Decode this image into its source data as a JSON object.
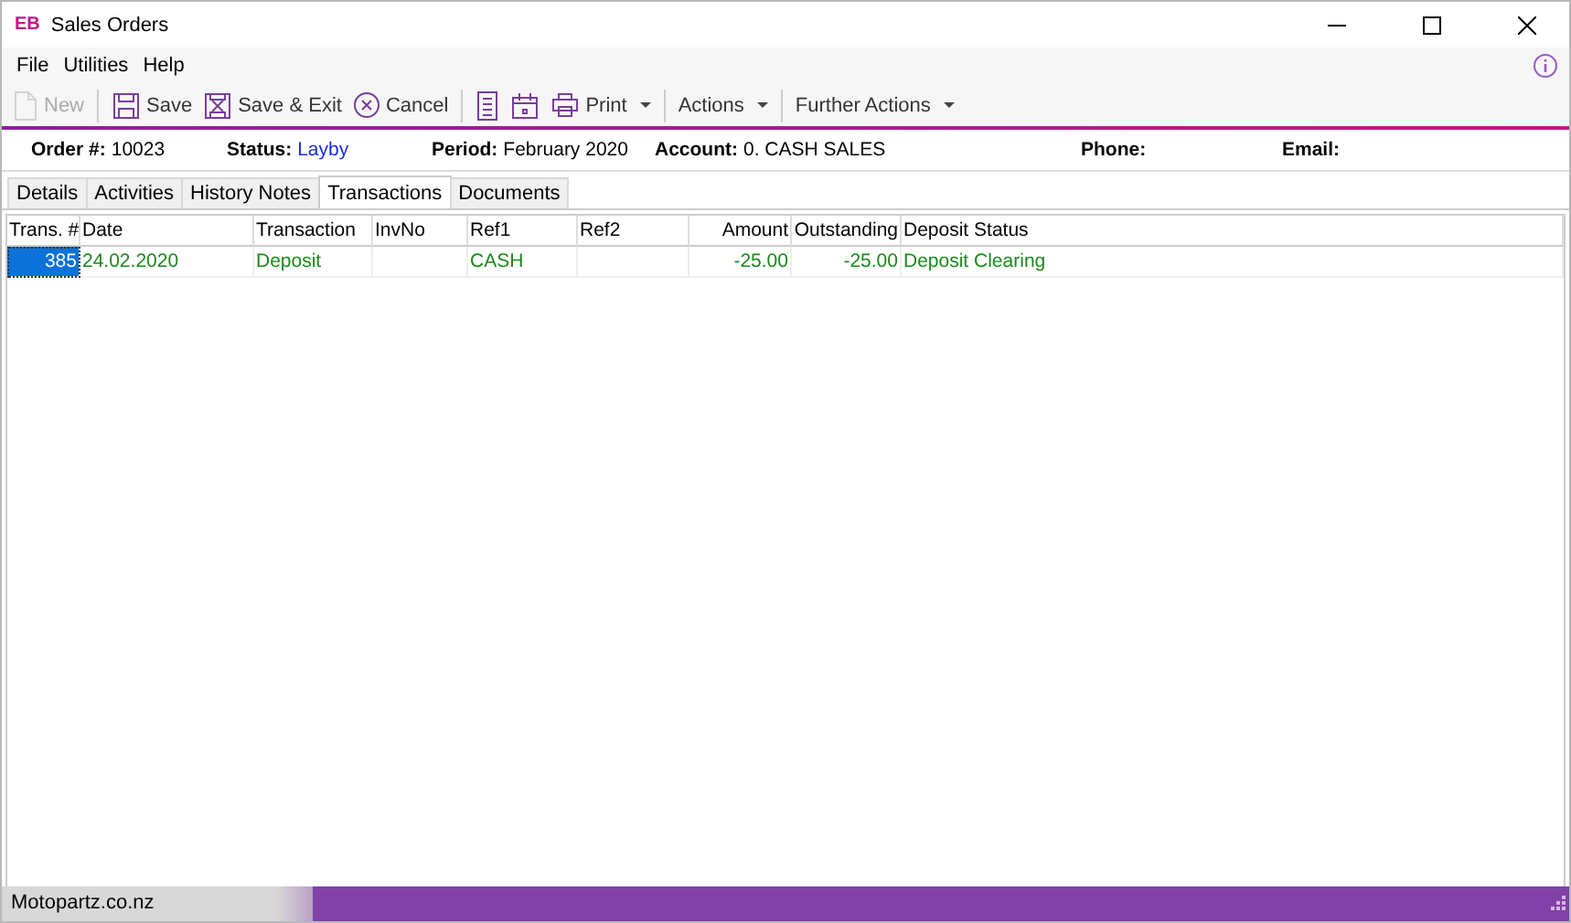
{
  "window": {
    "logo": "EB",
    "title": "Sales Orders"
  },
  "menu": [
    {
      "label": "File"
    },
    {
      "label": "Utilities"
    },
    {
      "label": "Help"
    }
  ],
  "toolbar": [
    {
      "kind": "document",
      "label": "New",
      "disabled": true
    },
    {
      "kind": "separator"
    },
    {
      "kind": "floppy",
      "label": "Save",
      "disabled": false
    },
    {
      "kind": "floppy-exit",
      "label": "Save & Exit",
      "disabled": false
    },
    {
      "kind": "cancel",
      "label": "Cancel",
      "disabled": false
    },
    {
      "kind": "separator"
    },
    {
      "kind": "list",
      "disabled": false
    },
    {
      "kind": "calendar",
      "disabled": false
    },
    {
      "kind": "printer",
      "label": "Print",
      "disabled": false,
      "dropdown": true
    },
    {
      "kind": "separator"
    },
    {
      "kind": "plain",
      "label": "Actions",
      "disabled": false,
      "dropdown": true
    },
    {
      "kind": "separator"
    },
    {
      "kind": "plain",
      "label": "Further Actions",
      "disabled": false,
      "dropdown": true
    }
  ],
  "header": [
    {
      "label": "Order #:",
      "value": "10023",
      "kind": "text"
    },
    {
      "label": "Status:",
      "value": "Layby",
      "kind": "status"
    },
    {
      "label": "Period:",
      "value": "February 2020",
      "kind": "text"
    },
    {
      "label": "Account:",
      "value": "0. CASH SALES",
      "kind": "text"
    },
    {
      "label": "Phone:"
    },
    {
      "label": "Email:"
    }
  ],
  "tabs": [
    {
      "label": "Details",
      "selected": false
    },
    {
      "label": "Activities",
      "selected": false
    },
    {
      "label": "History Notes",
      "selected": false
    },
    {
      "label": "Transactions",
      "selected": true
    },
    {
      "label": "Documents",
      "selected": false
    }
  ],
  "table": {
    "columns": [
      {
        "label": "Trans. #",
        "numeric": true
      },
      {
        "label": "Date",
        "numeric": false
      },
      {
        "label": "Transaction",
        "numeric": false
      },
      {
        "label": "InvNo",
        "numeric": false
      },
      {
        "label": "Ref1",
        "numeric": false
      },
      {
        "label": "Ref2",
        "numeric": false
      },
      {
        "label": "Amount",
        "numeric": true
      },
      {
        "label": "Outstanding",
        "numeric": true
      },
      {
        "label": "Deposit Status",
        "numeric": false
      }
    ],
    "rows": [
      {
        "selected": true,
        "cells": [
          "385",
          "24.02.2020",
          "Deposit",
          "",
          "CASH",
          "",
          "-25.00",
          "-25.00",
          "Deposit Clearing"
        ]
      }
    ]
  },
  "status_bar": {
    "text": "Motopartz.co.nz"
  }
}
